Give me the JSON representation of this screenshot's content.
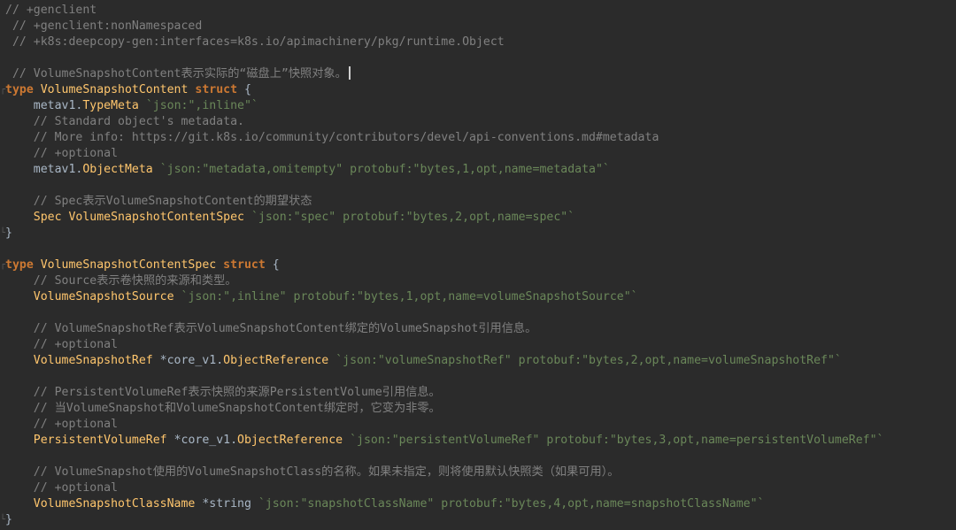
{
  "lines": [
    {
      "tokens": [
        {
          "t": "// +genclient",
          "c": "comment"
        }
      ]
    },
    {
      "tokens": [
        {
          "t": " // +genclient:nonNamespaced",
          "c": "comment"
        }
      ]
    },
    {
      "tokens": [
        {
          "t": " // +k8s:deepcopy-gen:interfaces=k8s.io/apimachinery/pkg/runtime.Object",
          "c": "comment"
        }
      ]
    },
    {
      "tokens": []
    },
    {
      "tokens": [
        {
          "t": " // VolumeSnapshotContent表示实际的“磁盘上”快照对象。",
          "c": "comment"
        }
      ],
      "cursor": true
    },
    {
      "tokens": [
        {
          "t": "type ",
          "c": "keyword"
        },
        {
          "t": "VolumeSnapshotContent ",
          "c": "typename"
        },
        {
          "t": "struct",
          "c": "keyword"
        },
        {
          "t": " {",
          "c": "plain"
        }
      ]
    },
    {
      "tokens": [
        {
          "t": "    metav1.",
          "c": "plain"
        },
        {
          "t": "TypeMeta",
          "c": "typename"
        },
        {
          "t": " ",
          "c": "plain"
        },
        {
          "t": "`json:\",inline\"`",
          "c": "string"
        }
      ]
    },
    {
      "tokens": [
        {
          "t": "    // Standard object's metadata.",
          "c": "comment"
        }
      ]
    },
    {
      "tokens": [
        {
          "t": "    // More info: https://git.k8s.io/community/contributors/devel/api-conventions.md#metadata",
          "c": "comment"
        }
      ]
    },
    {
      "tokens": [
        {
          "t": "    // +optional",
          "c": "comment"
        }
      ]
    },
    {
      "tokens": [
        {
          "t": "    metav1.",
          "c": "plain"
        },
        {
          "t": "ObjectMeta",
          "c": "typename"
        },
        {
          "t": " ",
          "c": "plain"
        },
        {
          "t": "`json:\"metadata,omitempty\" protobuf:\"bytes,1,opt,name=metadata\"`",
          "c": "string"
        }
      ]
    },
    {
      "tokens": []
    },
    {
      "tokens": [
        {
          "t": "    // Spec表示VolumeSnapshotContent的期望状态",
          "c": "comment"
        }
      ]
    },
    {
      "tokens": [
        {
          "t": "    Spec",
          "c": "typename"
        },
        {
          "t": " ",
          "c": "plain"
        },
        {
          "t": "VolumeSnapshotContentSpec",
          "c": "typename"
        },
        {
          "t": " ",
          "c": "plain"
        },
        {
          "t": "`json:\"spec\" protobuf:\"bytes,2,opt,name=spec\"`",
          "c": "string"
        }
      ]
    },
    {
      "tokens": [
        {
          "t": "}",
          "c": "plain"
        }
      ]
    },
    {
      "tokens": []
    },
    {
      "tokens": [
        {
          "t": "type ",
          "c": "keyword"
        },
        {
          "t": "VolumeSnapshotContentSpec ",
          "c": "typename"
        },
        {
          "t": "struct",
          "c": "keyword"
        },
        {
          "t": " {",
          "c": "plain"
        }
      ]
    },
    {
      "tokens": [
        {
          "t": "    // Source表示卷快照的来源和类型。",
          "c": "comment"
        }
      ]
    },
    {
      "tokens": [
        {
          "t": "    VolumeSnapshotSource",
          "c": "typename"
        },
        {
          "t": " ",
          "c": "plain"
        },
        {
          "t": "`json:\",inline\" protobuf:\"bytes,1,opt,name=volumeSnapshotSource\"`",
          "c": "string"
        }
      ]
    },
    {
      "tokens": []
    },
    {
      "tokens": [
        {
          "t": "    // VolumeSnapshotRef表示VolumeSnapshotContent绑定的VolumeSnapshot引用信息。",
          "c": "comment"
        }
      ]
    },
    {
      "tokens": [
        {
          "t": "    // +optional",
          "c": "comment"
        }
      ]
    },
    {
      "tokens": [
        {
          "t": "    VolumeSnapshotRef",
          "c": "typename"
        },
        {
          "t": " *core_v1.",
          "c": "plain"
        },
        {
          "t": "ObjectReference",
          "c": "typename"
        },
        {
          "t": " ",
          "c": "plain"
        },
        {
          "t": "`json:\"volumeSnapshotRef\" protobuf:\"bytes,2,opt,name=volumeSnapshotRef\"`",
          "c": "string"
        }
      ]
    },
    {
      "tokens": []
    },
    {
      "tokens": [
        {
          "t": "    // PersistentVolumeRef表示快照的来源PersistentVolume引用信息。",
          "c": "comment"
        }
      ]
    },
    {
      "tokens": [
        {
          "t": "    // 当VolumeSnapshot和VolumeSnapshotContent绑定时，它变为非零。",
          "c": "comment"
        }
      ]
    },
    {
      "tokens": [
        {
          "t": "    // +optional",
          "c": "comment"
        }
      ]
    },
    {
      "tokens": [
        {
          "t": "    PersistentVolumeRef",
          "c": "typename"
        },
        {
          "t": " *core_v1.",
          "c": "plain"
        },
        {
          "t": "ObjectReference",
          "c": "typename"
        },
        {
          "t": " ",
          "c": "plain"
        },
        {
          "t": "`json:\"persistentVolumeRef\" protobuf:\"bytes,3,opt,name=persistentVolumeRef\"`",
          "c": "string"
        }
      ]
    },
    {
      "tokens": []
    },
    {
      "tokens": [
        {
          "t": "    // VolumeSnapshot使用的VolumeSnapshotClass的名称。如果未指定，则将使用默认快照类（如果可用）。",
          "c": "comment"
        }
      ]
    },
    {
      "tokens": [
        {
          "t": "    // +optional",
          "c": "comment"
        }
      ]
    },
    {
      "tokens": [
        {
          "t": "    VolumeSnapshotClassName",
          "c": "typename"
        },
        {
          "t": " *string ",
          "c": "plain"
        },
        {
          "t": "`json:\"snapshotClassName\" protobuf:\"bytes,4,opt,name=snapshotClassName\"`",
          "c": "string"
        }
      ]
    },
    {
      "tokens": [
        {
          "t": "}",
          "c": "plain"
        }
      ]
    }
  ],
  "colors": {
    "background": "#2b2b2b",
    "comment": "#808080",
    "keyword": "#cc7832",
    "typename": "#ffc66d",
    "string": "#6a8759",
    "plain": "#a9b7c6"
  }
}
